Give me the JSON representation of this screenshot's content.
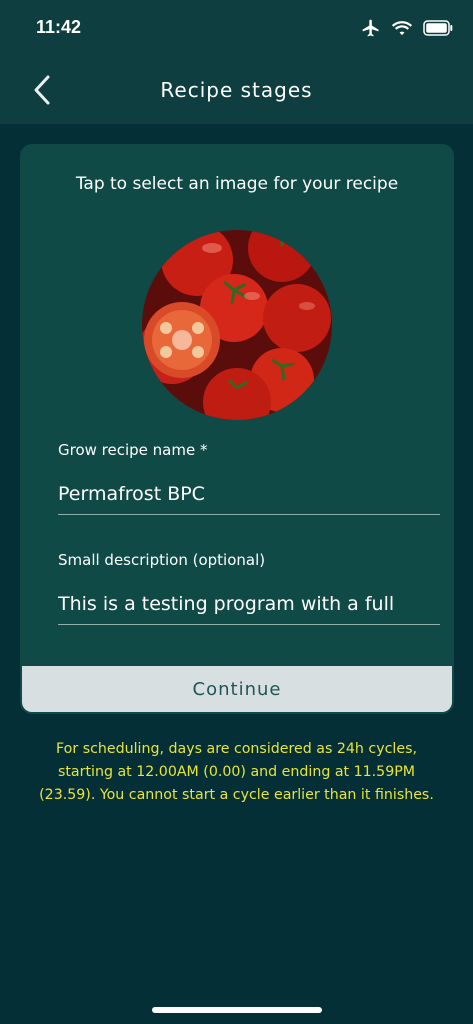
{
  "status_bar": {
    "time": "11:42",
    "icons": [
      "airplane-icon",
      "wifi-icon",
      "battery-icon"
    ]
  },
  "nav": {
    "title": "Recipe stages",
    "back_icon": "chevron-left-icon"
  },
  "card": {
    "hint": "Tap to select an image for your recipe",
    "image_subject": "tomatoes",
    "name_field": {
      "label": "Grow recipe name *",
      "value": "Permafrost BPC"
    },
    "description_field": {
      "label": "Small description (optional)",
      "value": "This is a testing program with a full"
    },
    "continue_label": "Continue"
  },
  "notice": "For scheduling, days are considered as 24h cycles, starting at 12.00AM (0.00) and ending at 11.59PM (23.59). You cannot start a cycle earlier than it finishes.",
  "colors": {
    "background": "#052f36",
    "header": "#0e3e40",
    "card": "#0f4a46",
    "button": "#d7dfe0",
    "button_text": "#1f5655",
    "notice_text": "#e7e43a"
  }
}
